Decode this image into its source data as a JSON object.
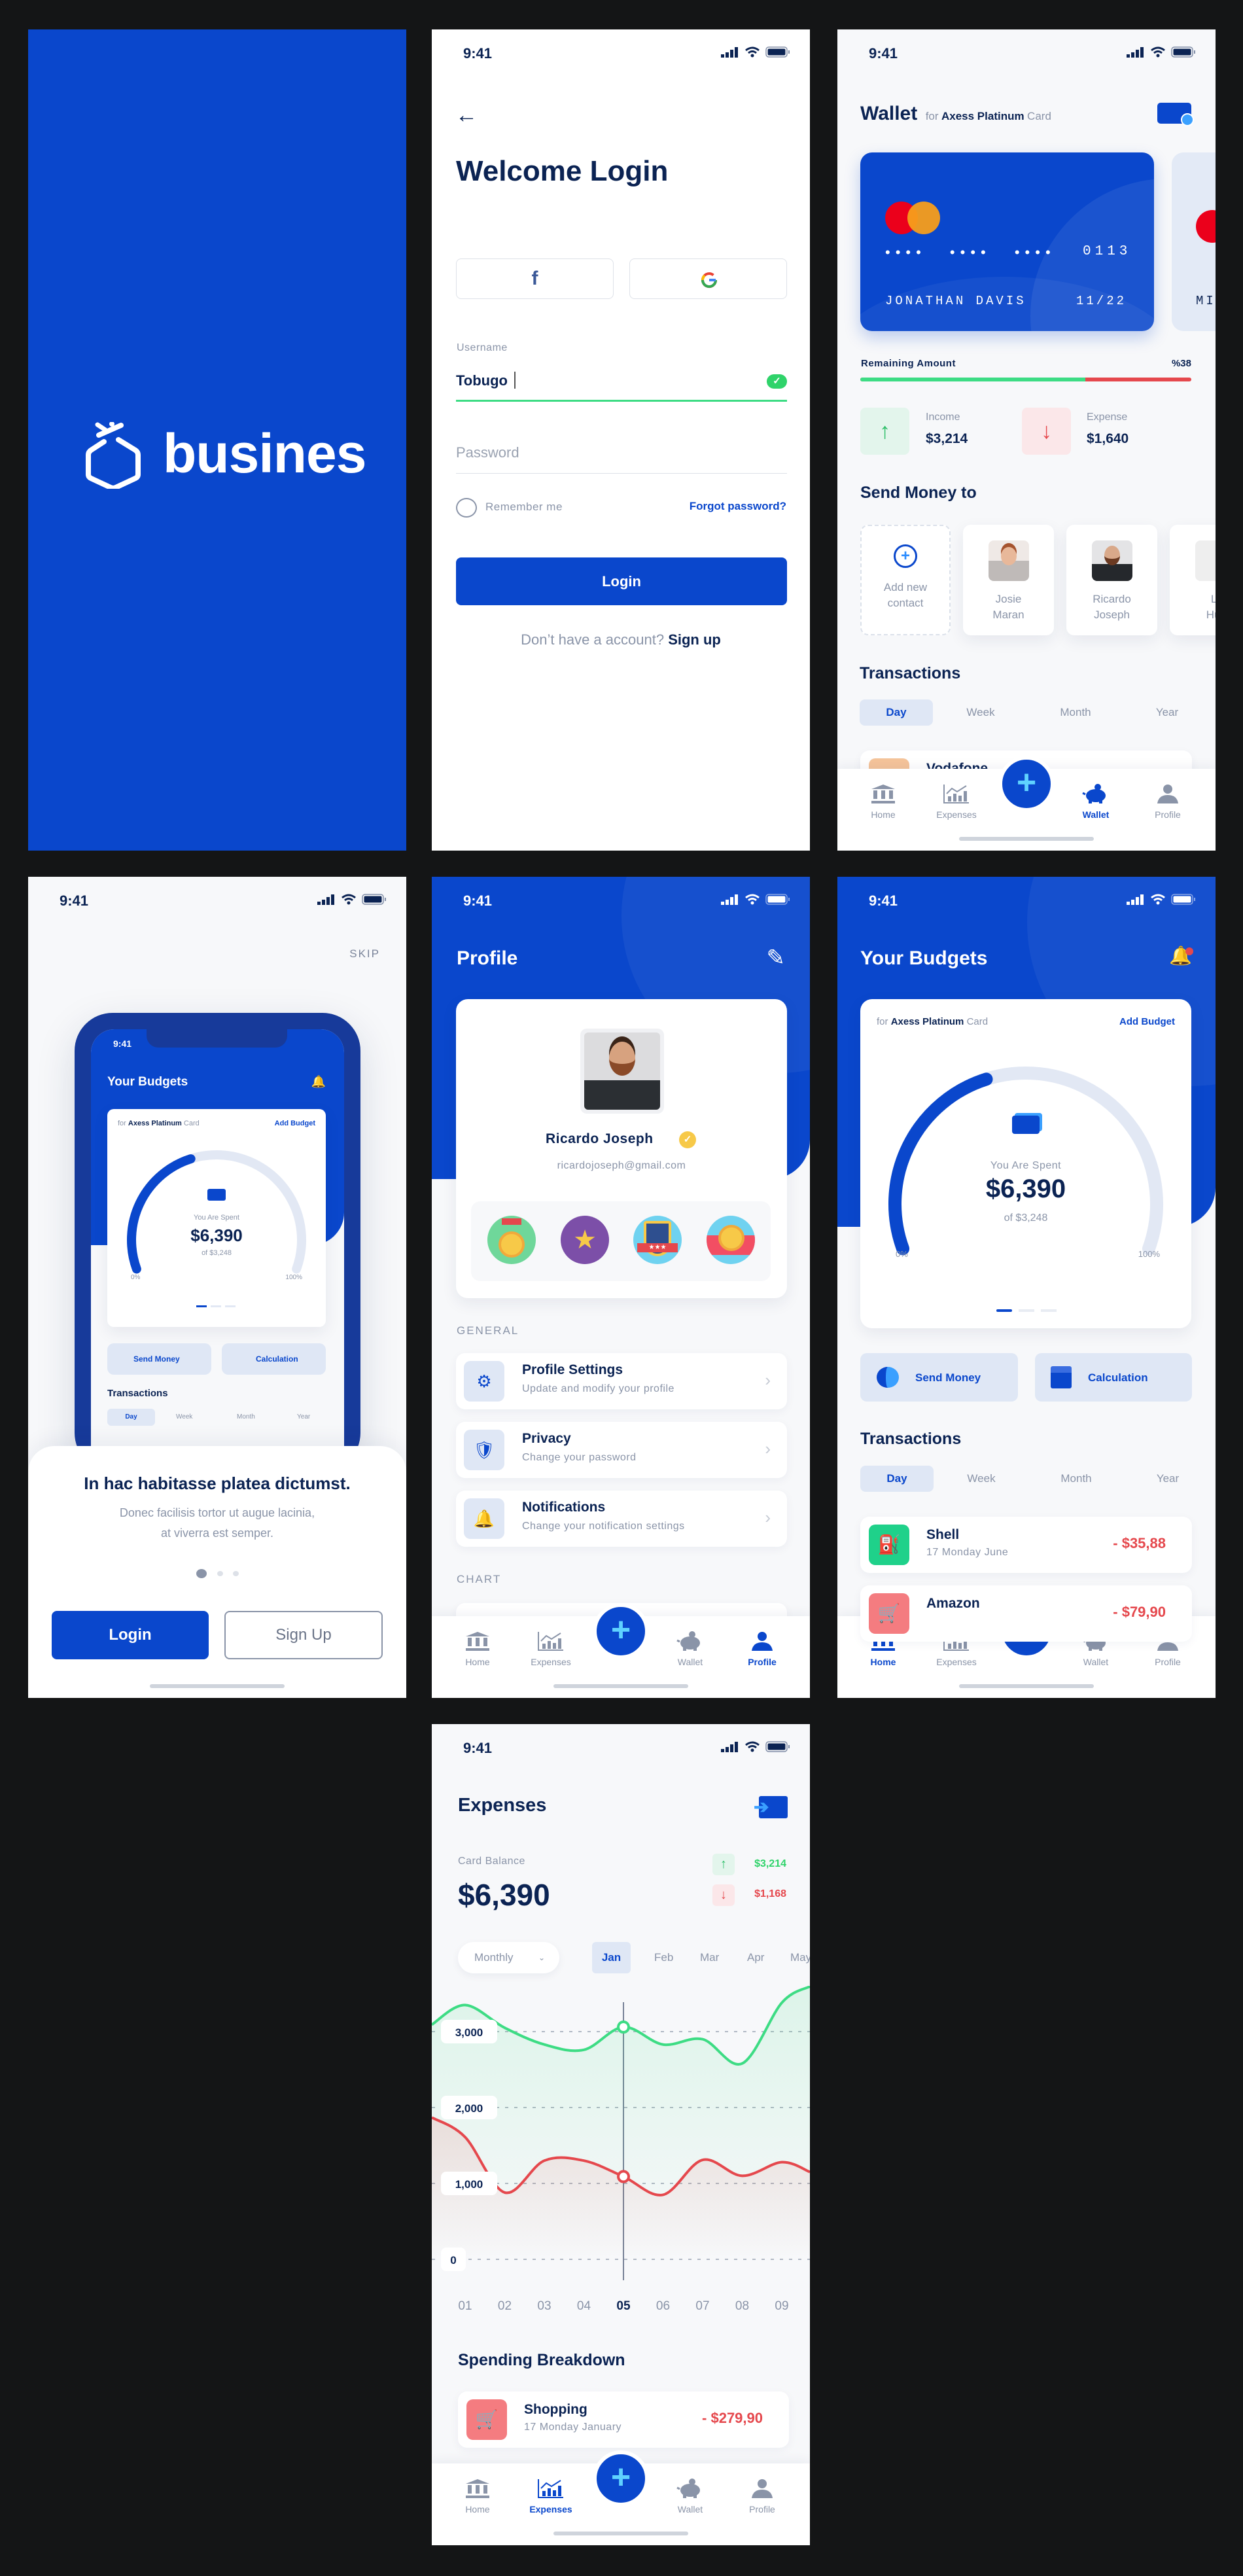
{
  "status_time": "9:41",
  "colors": {
    "brand": "#0a47cc",
    "navy": "#0b2353",
    "green": "#3ddc84",
    "red": "#e5484d",
    "background": "#141516"
  },
  "nav": {
    "items": [
      "Home",
      "Expenses",
      "Wallet",
      "Profile"
    ],
    "fab_icon": "plus-icon"
  },
  "splash": {
    "brand": "busines"
  },
  "login": {
    "title": "Welcome Login",
    "social": [
      "facebook",
      "google"
    ],
    "username_label": "Username",
    "username_value": "Tobugo",
    "password_placeholder": "Password",
    "remember": "Remember me",
    "forgot": "Forgot password?",
    "login": "Login",
    "no_account": "Don’t have a account?",
    "signup": "Sign up"
  },
  "wallet": {
    "title": "Wallet",
    "for": "for",
    "card_name": "Axess Platinum",
    "card_word": "Card",
    "card": {
      "dots": "•••• •••• ••••",
      "last4": "0113",
      "holder": "JONATHAN DAVIS",
      "expiry": "11/22",
      "next_holder": "MI"
    },
    "remaining_label": "Remaining Amount",
    "remaining_value": "%38",
    "bar_green_fraction": 0.68,
    "income_label": "Income",
    "income_value": "$3,214",
    "expense_label": "Expense",
    "expense_value": "$1,640",
    "send_title": "Send Money to",
    "contacts": [
      {
        "line1": "Add new",
        "line2": "contact"
      },
      {
        "line1": "Josie",
        "line2": "Maran"
      },
      {
        "line1": "Ricardo",
        "line2": "Joseph"
      },
      {
        "line1": "Li",
        "line2": "Hur"
      }
    ],
    "transactions_title": "Transactions",
    "tabs": [
      "Day",
      "Week",
      "Month",
      "Year"
    ],
    "partial_row": "Vodafone",
    "active_nav": "Wallet"
  },
  "onboarding": {
    "skip": "SKIP",
    "title": "In hac habitasse platea dictumst.",
    "body1": "Donec facilisis tortor ut augue lacinia,",
    "body2": "at viverra est semper.",
    "login": "Login",
    "signup": "Sign Up",
    "mock": {
      "title": "Your Budgets",
      "for": "for",
      "card_name": "Axess Platinum",
      "card_word": "Card",
      "add_budget": "Add Budget",
      "spent_label": "You Are Spent",
      "spent": "$6,390",
      "of": "of $3,248",
      "min": "0%",
      "max": "100%",
      "send": "Send Money",
      "calc": "Calculation",
      "transactions": "Transactions",
      "tabs": [
        "Day",
        "Week",
        "Month",
        "Year"
      ]
    }
  },
  "profile": {
    "title": "Profile",
    "name": "Ricardo Joseph",
    "email": "ricardojoseph@gmail.com",
    "badges": [
      "medal-badge",
      "star-laurel-badge",
      "shield-stars-badge",
      "first-place-badge"
    ],
    "general": "GENERAL",
    "items": [
      {
        "title": "Profile Settings",
        "sub": "Update and modify your profile",
        "icon": "gear-icon"
      },
      {
        "title": "Privacy",
        "sub": "Change your password",
        "icon": "shield-icon"
      },
      {
        "title": "Notifications",
        "sub": "Change your notification settings",
        "icon": "bell-icon"
      }
    ],
    "chart": "CHART",
    "active_nav": "Profile"
  },
  "budgets": {
    "title": "Your Budgets",
    "for": "for",
    "card_name": "Axess Platinum",
    "card_word": "Card",
    "add_budget": "Add Budget",
    "spent_label": "You Are Spent",
    "spent": "$6,390",
    "of": "of $3,248",
    "min": "0%",
    "max": "100%",
    "gauge_fraction": 0.42,
    "send": "Send Money",
    "calc": "Calculation",
    "transactions": "Transactions",
    "tabs": [
      "Day",
      "Week",
      "Month",
      "Year"
    ],
    "rows": [
      {
        "title": "Shell",
        "date": "17 Monday June",
        "amount": "- $35,88",
        "color": "#1fd18a"
      },
      {
        "title": "Amazon",
        "date": "",
        "amount": "- $79,90",
        "color": "#f47c80"
      }
    ],
    "active_nav": "Home"
  },
  "expenses": {
    "title": "Expenses",
    "balance_label": "Card Balance",
    "balance": "$6,390",
    "income": "$3,214",
    "expense": "$1,168",
    "period": "Monthly",
    "months": [
      "Jan",
      "Feb",
      "Mar",
      "Apr",
      "May"
    ],
    "active_month": "Jan",
    "breakdown_title": "Spending Breakdown",
    "row": {
      "title": "Shopping",
      "date": "17 Monday January",
      "amount": "- $279,90"
    },
    "active_nav": "Expenses"
  },
  "chart_data": {
    "type": "line",
    "x": [
      "01",
      "02",
      "03",
      "04",
      "05",
      "06",
      "07",
      "08",
      "09"
    ],
    "highlight_x": "05",
    "yticks": [
      "0",
      "1,000",
      "2,000",
      "3,000"
    ],
    "ylim": [
      0,
      3000
    ],
    "grid": true,
    "series": [
      {
        "color": "#3ddc84",
        "values": [
          3350,
          3050,
          2830,
          2760,
          3060,
          2830,
          2900,
          2580,
          3380
        ]
      },
      {
        "color": "#e5484d",
        "values": [
          1610,
          880,
          1300,
          1300,
          1090,
          850,
          1310,
          1100,
          1280
        ]
      }
    ]
  }
}
